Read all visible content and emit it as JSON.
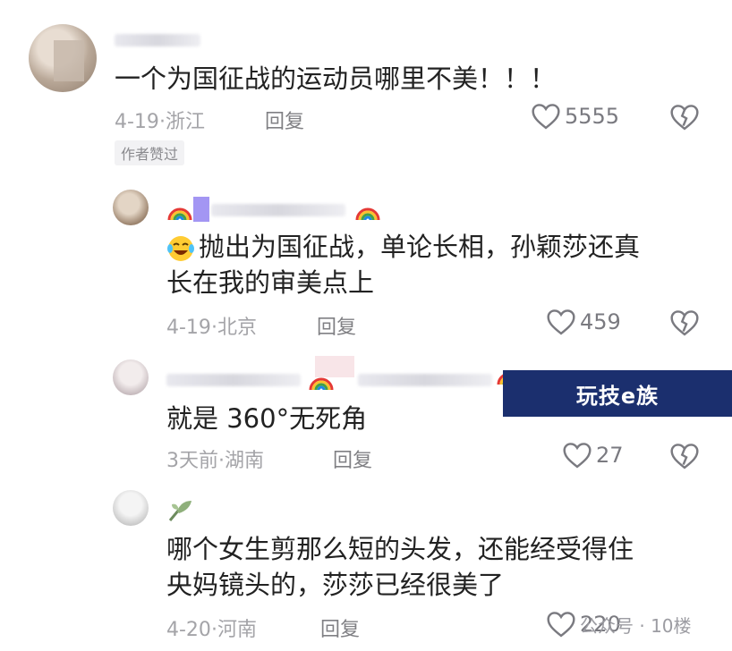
{
  "comments": [
    {
      "text_lines": [
        "一个为国征战的运动员哪里不美！！！"
      ],
      "date": "4-19",
      "location": "浙江",
      "reply_label": "回复",
      "likes": "5555",
      "badge": "作者赞过"
    },
    {
      "text_lines": [
        "抛出为国征战，单论长相，孙颖莎还真",
        "长在我的审美点上"
      ],
      "date": "4-19",
      "location": "北京",
      "reply_label": "回复",
      "likes": "459"
    },
    {
      "text_lines": [
        "就是 360°无死角"
      ],
      "date": "3天前",
      "location": "湖南",
      "reply_label": "回复",
      "likes": "27"
    },
    {
      "text_lines": [
        "哪个女生剪那么短的头发，还能经受得住",
        "央妈镜头的，莎莎已经很美了"
      ],
      "date": "4-20",
      "location": "河南",
      "reply_label": "回复",
      "likes": "220"
    }
  ],
  "meta_separator": "·",
  "watermark": "玩技e族",
  "footer_watermark": "公众号 · 10楼",
  "colors": {
    "text": "#222222",
    "meta": "#a4a4a8",
    "watermark_bg": "#1b2f6e"
  },
  "icons": [
    "heart-outline-icon",
    "broken-heart-icon",
    "rainbow-emoji-icon",
    "laughing-crying-emoji-icon"
  ]
}
